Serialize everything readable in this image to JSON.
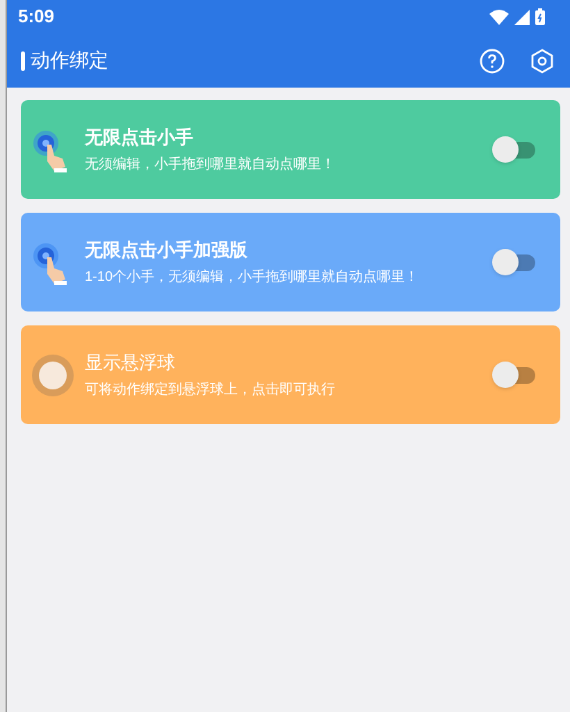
{
  "status_bar": {
    "time": "5:09"
  },
  "app_bar": {
    "title": "动作绑定"
  },
  "cards": [
    {
      "kind": "hand",
      "title": "无限点击小手",
      "subtitle": "无须编辑，小手拖到哪里就自动点哪里！",
      "on": false,
      "color": "#4ecb9f"
    },
    {
      "kind": "hand",
      "title": "无限点击小手加强版",
      "subtitle": "1-10个小手，无须编辑，小手拖到哪里就自动点哪里！",
      "on": false,
      "color": "#6aaaf9"
    },
    {
      "kind": "ball",
      "title": "显示悬浮球",
      "subtitle": "可将动作绑定到悬浮球上，点击即可执行",
      "on": false,
      "color": "#ffb25c"
    }
  ]
}
